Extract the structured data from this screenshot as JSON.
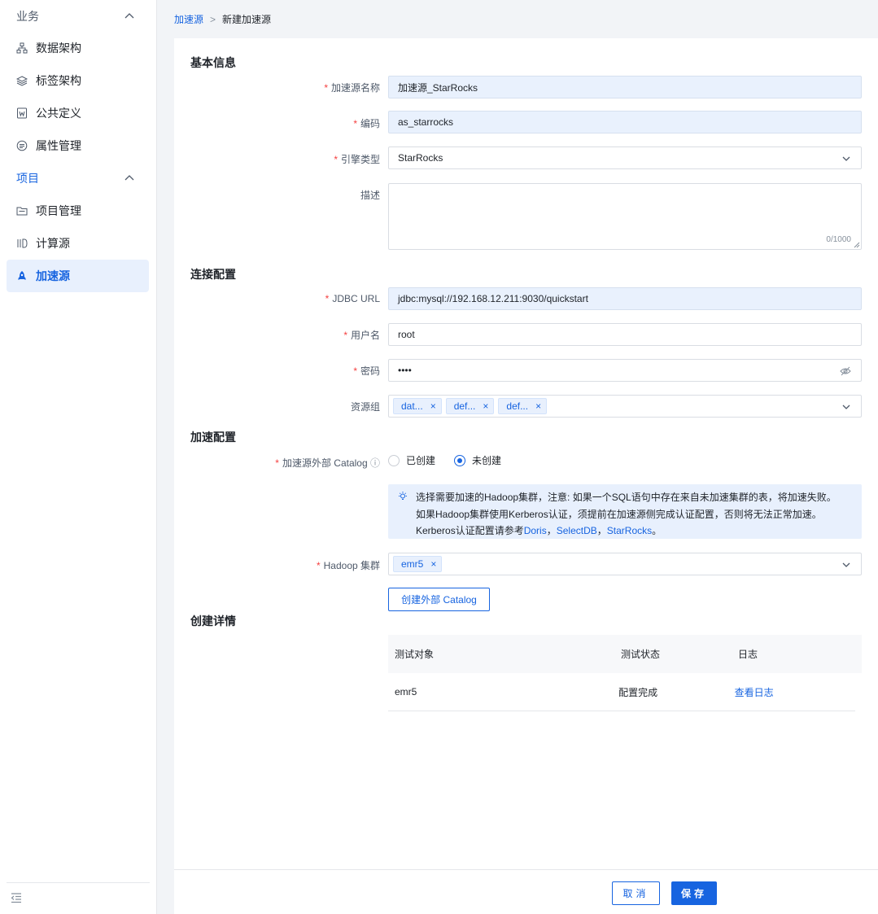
{
  "sidebar": {
    "groups": [
      {
        "label": "业务"
      },
      {
        "label": "项目"
      }
    ],
    "items": [
      {
        "label": "数据架构",
        "icon": "hierarchy-icon"
      },
      {
        "label": "标签架构",
        "icon": "layers-icon"
      },
      {
        "label": "公共定义",
        "icon": "w-document-icon"
      },
      {
        "label": "属性管理",
        "icon": "attribute-icon"
      },
      {
        "label": "项目管理",
        "icon": "folder-icon"
      },
      {
        "label": "计算源",
        "icon": "compute-icon"
      },
      {
        "label": "加速源",
        "icon": "rocket-icon"
      }
    ],
    "active_item": "加速源"
  },
  "breadcrumb": {
    "parent": "加速源",
    "separator": ">",
    "current": "新建加速源"
  },
  "sections": {
    "basic": "基本信息",
    "connection": "连接配置",
    "acceleration": "加速配置",
    "details": "创建详情"
  },
  "form": {
    "name": {
      "label": "加速源名称",
      "value": "加速源_StarRocks"
    },
    "code": {
      "label": "编码",
      "value": "as_starrocks"
    },
    "engine": {
      "label": "引擎类型",
      "value": "StarRocks"
    },
    "description": {
      "label": "描述",
      "value": "",
      "counter": "0/1000"
    },
    "jdbc": {
      "label": "JDBC URL",
      "value": "jdbc:mysql://192.168.12.211:9030/quickstart"
    },
    "username": {
      "label": "用户名",
      "value": "root"
    },
    "password": {
      "label": "密码",
      "value": "••••"
    },
    "resource_group": {
      "label": "资源组",
      "tags": [
        "dat...",
        "def...",
        "def..."
      ]
    },
    "catalog": {
      "label": "加速源外部 Catalog",
      "info_icon": "ⓘ",
      "options": [
        "已创建",
        "未创建"
      ],
      "selected": "未创建"
    },
    "tip": {
      "line1": "选择需要加速的Hadoop集群，注意: 如果一个SQL语句中存在来自未加速集群的表，将加速失败。",
      "line2": "如果Hadoop集群使用Kerberos认证，须提前在加速源侧完成认证配置，否则将无法正常加速。",
      "line3_prefix": "Kerberos认证配置请参考",
      "links": [
        "Doris",
        "SelectDB",
        "StarRocks"
      ],
      "sep": "，",
      "end": "。"
    },
    "hadoop": {
      "label": "Hadoop 集群",
      "tags": [
        "emr5"
      ]
    },
    "create_catalog_button": "创建外部 Catalog"
  },
  "table": {
    "headers": [
      "测试对象",
      "测试状态",
      "日志"
    ],
    "rows": [
      {
        "object": "emr5",
        "status": "配置完成",
        "log": "查看日志"
      }
    ]
  },
  "footer": {
    "cancel": "取消",
    "save": "保存"
  },
  "colors": {
    "accent": "#1764e0",
    "required": "#f53f3f"
  }
}
